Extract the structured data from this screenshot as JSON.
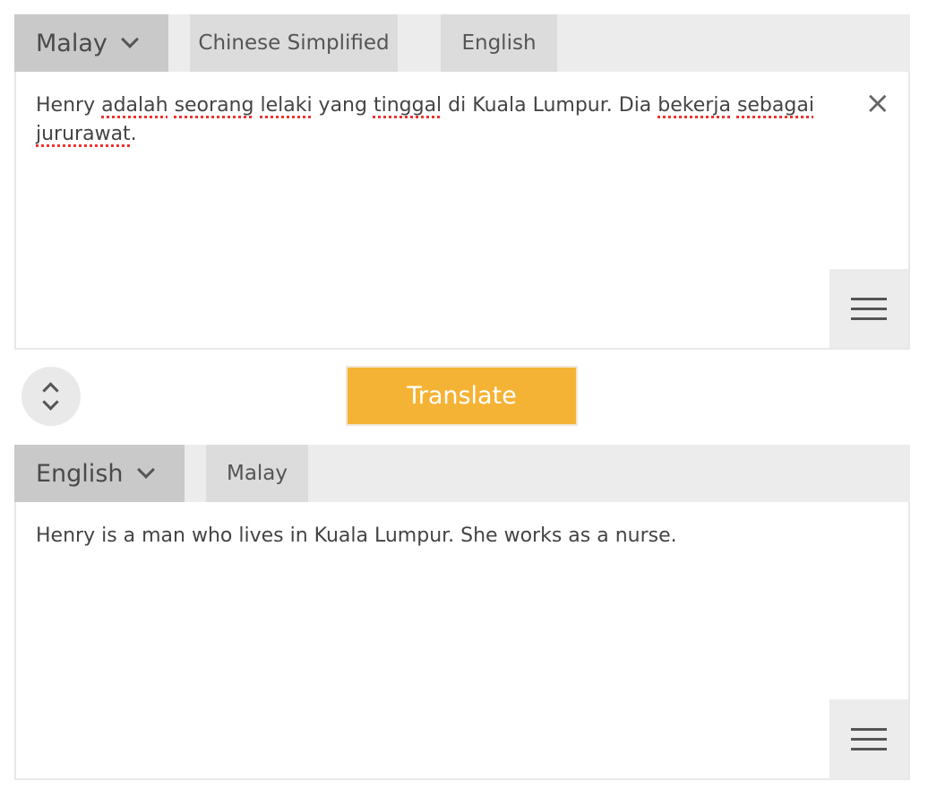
{
  "source": {
    "selected_language": "Malay",
    "recent_languages": [
      "Chinese Simplified",
      "English"
    ],
    "text_words": [
      "Henry ",
      "adalah",
      " ",
      "seorang",
      " ",
      "lelaki",
      " yang ",
      "tinggal",
      " di Kuala Lumpur. Dia ",
      "bekerja",
      " ",
      "sebagai",
      " ",
      "jururawat",
      "."
    ],
    "close_icon": "×"
  },
  "translate_label": "Translate",
  "target": {
    "selected_language": "English",
    "recent_languages": [
      "Malay"
    ],
    "text": "Henry is a man who lives in Kuala Lumpur. She works as a nurse."
  },
  "colors": {
    "accent": "#f5b335"
  }
}
